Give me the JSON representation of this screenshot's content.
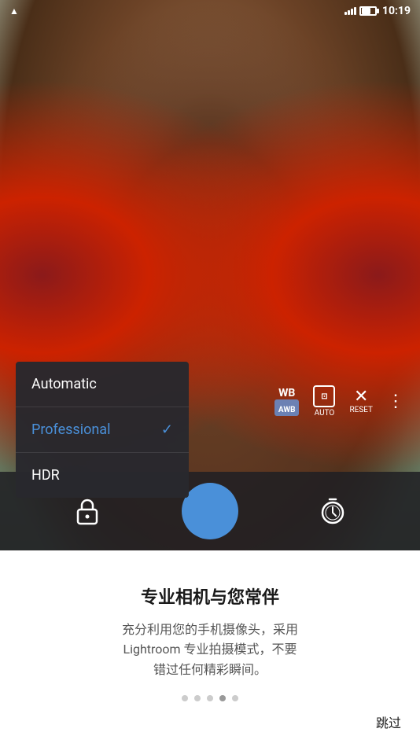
{
  "statusBar": {
    "leftIcon": "A",
    "time": "10:19"
  },
  "camera": {
    "wbLabel": "WB",
    "wbBadge": "AWB",
    "autoLabel": "AUTO",
    "resetLabel": "RESET"
  },
  "dropdown": {
    "items": [
      {
        "id": "automatic",
        "label": "Automatic",
        "selected": false
      },
      {
        "id": "professional",
        "label": "Professional",
        "selected": true
      },
      {
        "id": "hdr",
        "label": "HDR",
        "selected": false
      }
    ]
  },
  "bottomInfo": {
    "title": "专业相机与您常伴",
    "description": "充分利用您的手机摄像头，采用\nLightroom 专业拍摄模式，不要\n错过任何精彩瞬间。",
    "dots": [
      {
        "active": false
      },
      {
        "active": false
      },
      {
        "active": false
      },
      {
        "active": true
      },
      {
        "active": false
      }
    ],
    "skipLabel": "跳过"
  }
}
